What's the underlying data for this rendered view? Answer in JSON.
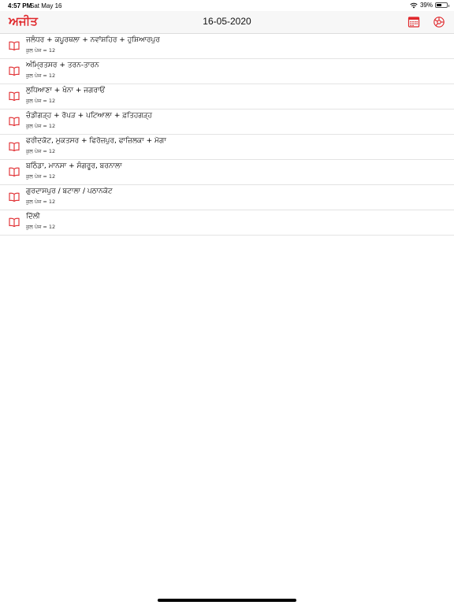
{
  "status_bar": {
    "time": "4:57 PM",
    "date": "Sat May 16",
    "battery_text": "39%"
  },
  "navbar": {
    "logo": "ਅਜੀਤ",
    "title": "16-05-2020"
  },
  "editions": [
    {
      "title": "ਜਲੰਧਰ + ਕਪੂਰਥਲਾ + ਨਵਾਂਸ਼ਹਿਰ + ਹੁਸ਼ਿਆਰਪੁਰ",
      "subtitle": "ਕੁਲ ਪੇਜ = 12"
    },
    {
      "title": "ਅੰਮ੍ਰਿਤਸਰ + ਤਰਨ-ਤਾਰਨ",
      "subtitle": "ਕੁਲ ਪੇਜ = 12"
    },
    {
      "title": "ਲੁਧਿਆਣਾ + ਖੰਨਾ + ਜਗਰਾਓਂ",
      "subtitle": "ਕੁਲ ਪੇਜ = 12"
    },
    {
      "title": "ਚੰਡੀਗੜ੍ਹ + ਰੋਪੜ + ਪਟਿਆਲਾ + ਫ਼ਤਿਹਗੜ੍ਹ",
      "subtitle": "ਕੁਲ ਪੇਜ = 12"
    },
    {
      "title": "ਫਰੀਦਕੋਟ, ਮੁਕਤਸਰ + ਫਿਰੋਜ਼ਪੁਰ, ਫਾਜ਼ਿਲਕਾ + ਮੋਗਾ",
      "subtitle": "ਕੁਲ ਪੇਜ = 12"
    },
    {
      "title": "ਬਠਿੰਡਾ, ਮਾਨਸਾ + ਸੰਗਰੂਰ, ਬਰਨਾਲਾ",
      "subtitle": "ਕੁਲ ਪੇਜ = 12"
    },
    {
      "title": "ਗੁਰਦਾਸਪੁਰ / ਬਟਾਲਾ / ਪਠਾਨਕੋਟ",
      "subtitle": "ਕੁਲ ਪੇਜ = 12"
    },
    {
      "title": "ਦਿੱਲੀ",
      "subtitle": "ਕੁਲ ਪੇਜ = 12"
    }
  ],
  "colors": {
    "accent": "#e0282c",
    "separator": "#e3e3e3",
    "navbar_bg": "#f7f7f7"
  },
  "icons": {
    "row_icon": "open-book-icon",
    "calendar": "calendar-icon",
    "settings": "settings-gear-icon"
  }
}
